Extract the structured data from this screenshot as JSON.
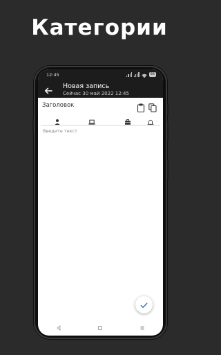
{
  "promo": {
    "title": "Категории"
  },
  "status_bar": {
    "time": "12:45",
    "battery": "66"
  },
  "app_bar": {
    "title": "Новая запись",
    "subtitle": "Сейчас 30 май 2022  12:45"
  },
  "editor": {
    "heading_placeholder": "Заголовок",
    "text_placeholder": "Введите текст"
  },
  "categories": [
    {
      "icon": "person-icon"
    },
    {
      "icon": "laptop-icon"
    },
    {
      "icon": "briefcase-icon"
    },
    {
      "icon": "bell-icon"
    }
  ],
  "colors": {
    "background": "#2b2b2b",
    "app_bar": "#1c1c1c",
    "accent": "#3d6fb0"
  }
}
